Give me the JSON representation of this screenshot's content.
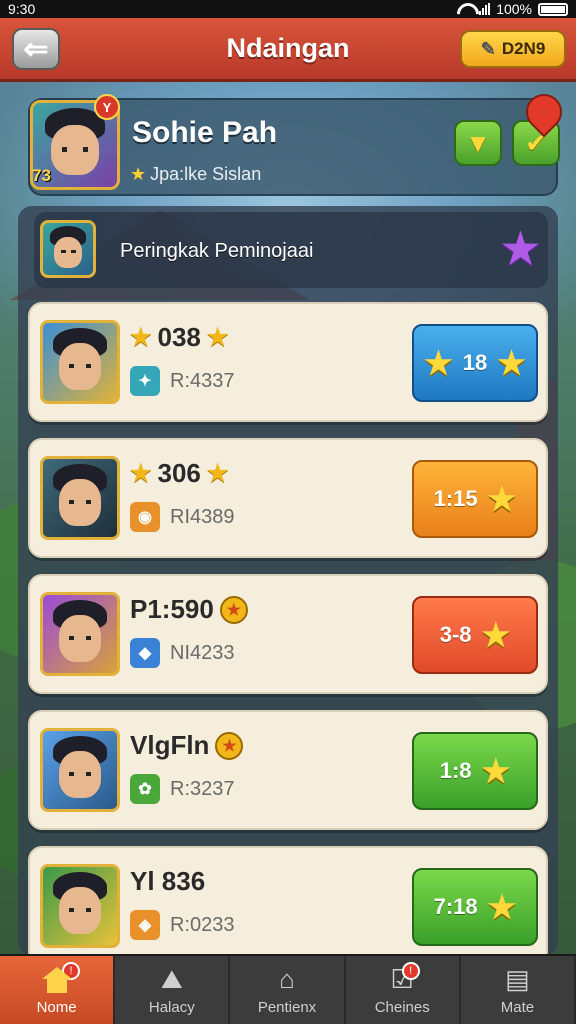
{
  "status_bar": {
    "time": "9:30",
    "battery_text": "100%"
  },
  "header": {
    "back_icon": "back-arrow-icon",
    "title": "Ndaingan",
    "coin_label": "D2N9"
  },
  "profile": {
    "name": "Sohie Pah",
    "subtitle": "Jpa:lke Sislan",
    "level": "73",
    "badge": "Y"
  },
  "ranking": {
    "title": "Peringkak Peminojaai"
  },
  "players": [
    {
      "score": "038",
      "sub": "R:4337",
      "action": "18",
      "btn_class": "btn-blue",
      "avatar_class": "bg-p1",
      "mini_class": "mi-teal",
      "mini_glyph": "✦",
      "score_prefix_star": true,
      "score_badge": "star"
    },
    {
      "score": "306",
      "sub": "RI4389",
      "action": "1:15",
      "btn_class": "btn-orange",
      "avatar_class": "bg-p2",
      "mini_class": "mi-orange",
      "mini_glyph": "◉",
      "score_prefix_star": true,
      "score_badge": "star"
    },
    {
      "score": "P1:590",
      "sub": "NI4233",
      "action": "3-8",
      "btn_class": "btn-red",
      "avatar_class": "bg-p3",
      "mini_class": "mi-blue",
      "mini_glyph": "◆",
      "score_prefix_star": false,
      "score_badge": "medal"
    },
    {
      "score": "VlgFln",
      "sub": "R:3237",
      "action": "1:8",
      "btn_class": "btn-green",
      "avatar_class": "bg-p4",
      "mini_class": "mi-green",
      "mini_glyph": "✿",
      "score_prefix_star": false,
      "score_badge": "medal"
    },
    {
      "score": "Yl 836",
      "sub": "R:0233",
      "action": "7:18",
      "btn_class": "btn-green",
      "avatar_class": "bg-p5",
      "mini_class": "mi-orange",
      "mini_glyph": "◈",
      "score_prefix_star": false,
      "score_badge": "none"
    }
  ],
  "nav": [
    {
      "label": "Nome",
      "icon": "home-icon",
      "active": true,
      "badge": "!"
    },
    {
      "label": "Halacy",
      "icon": "map-icon",
      "active": false,
      "badge": ""
    },
    {
      "label": "Pentienx",
      "icon": "house-icon",
      "active": false,
      "badge": ""
    },
    {
      "label": "Cheines",
      "icon": "checklist-icon",
      "active": false,
      "badge": "!"
    },
    {
      "label": "Mate",
      "icon": "chest-icon",
      "active": false,
      "badge": ""
    }
  ]
}
